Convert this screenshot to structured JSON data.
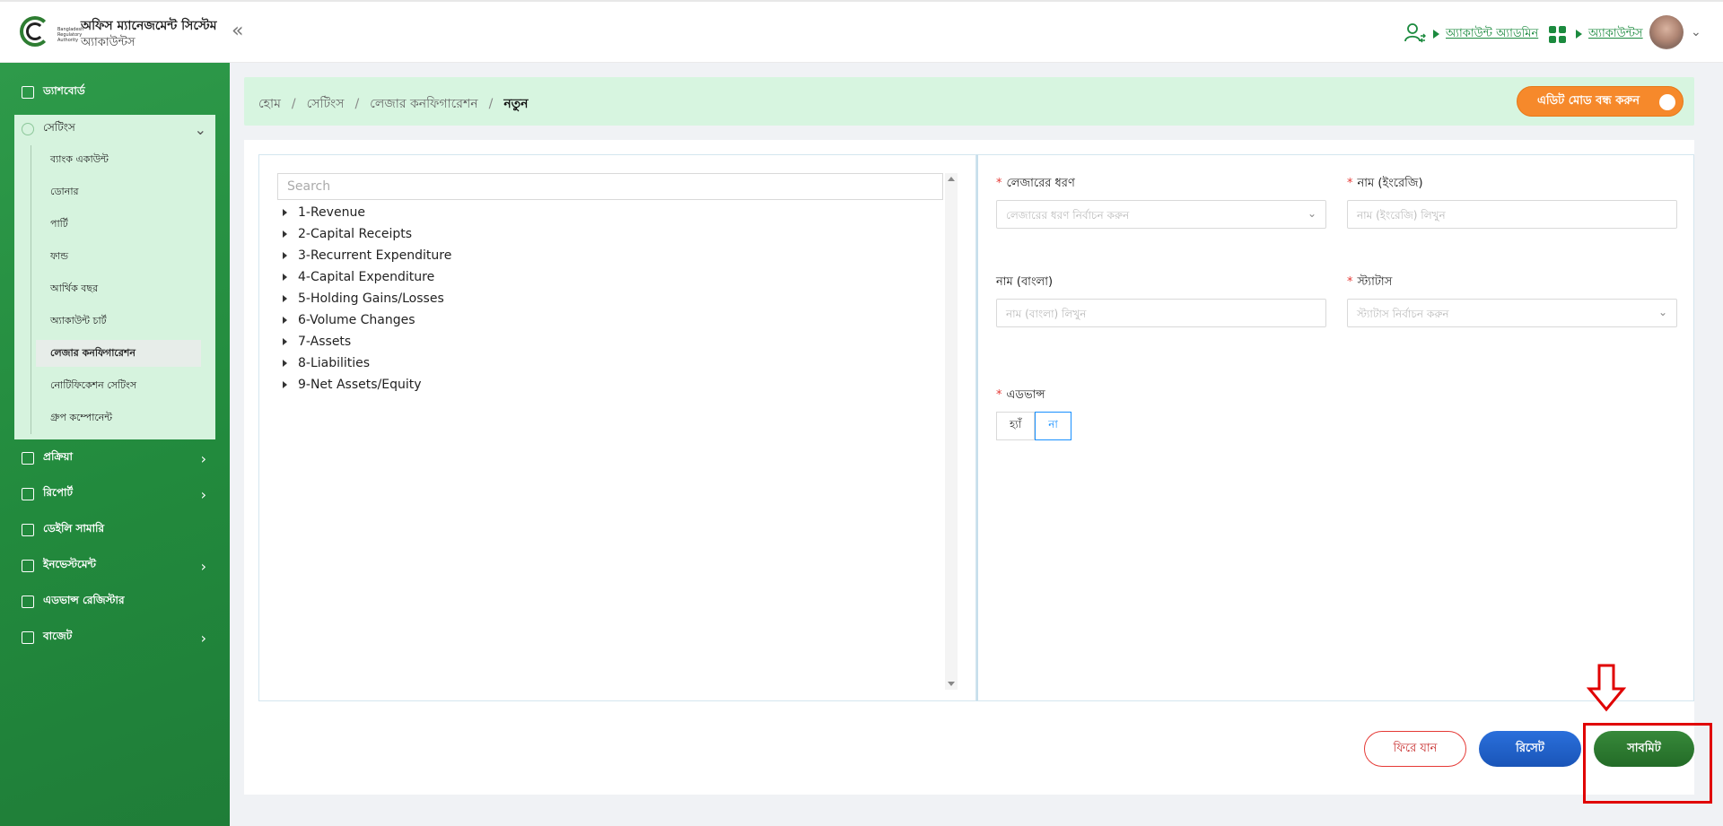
{
  "header": {
    "logo_text": "Bangladesh Regulatory Authority",
    "app_title": "অফিস ম্যানেজমেন্ট সিস্টেম",
    "app_subtitle": "অ্যাকাউন্টস",
    "collapse_glyph": "«",
    "user_link": "অ্যাকাউন্ট অ্যাডমিন",
    "module_link": "অ্যাকাউন্টস"
  },
  "sidebar": {
    "items": [
      {
        "label": "ড্যাশবোর্ড"
      },
      {
        "label": "প্রক্রিয়া"
      },
      {
        "label": "রিপোর্ট"
      },
      {
        "label": "ডেইলি সামারি"
      },
      {
        "label": "ইনভেস্টমেন্ট"
      },
      {
        "label": "এডভান্স রেজিস্টার"
      },
      {
        "label": "বাজেট"
      }
    ],
    "settings": {
      "label": "সেটিংস",
      "children": [
        {
          "label": "ব্যাংক একাউন্ট"
        },
        {
          "label": "ডোনার"
        },
        {
          "label": "পার্টি"
        },
        {
          "label": "ফান্ড"
        },
        {
          "label": "আর্থিক বছর"
        },
        {
          "label": "অ্যাকাউন্ট চার্ট"
        },
        {
          "label": "লেজার কনফিগারেশন"
        },
        {
          "label": "নোটিফিকেশন সেটিংস"
        },
        {
          "label": "গ্রুপ কম্পোনেন্ট"
        }
      ]
    }
  },
  "breadcrumb": {
    "home": "হোম",
    "settings": "সেটিংস",
    "ledger_config": "লেজার কনফিগারেশন",
    "current": "নতুন",
    "separator": "/"
  },
  "edit_mode": {
    "label": "এডিট মোড বন্ধ করুন"
  },
  "tree": {
    "search_placeholder": "Search",
    "nodes": [
      "1-Revenue",
      "2-Capital Receipts",
      "3-Recurrent Expenditure",
      "4-Capital Expenditure",
      "5-Holding Gains/Losses",
      "6-Volume Changes",
      "7-Assets",
      "8-Liabilities",
      "9-Net Assets/Equity"
    ]
  },
  "form": {
    "required_mark": "*",
    "ledger_type": {
      "label": "লেজারের ধরণ",
      "placeholder": "লেজারের ধরণ নির্বাচন করুন"
    },
    "name_en": {
      "label": "নাম (ইংরেজি)",
      "placeholder": "নাম (ইংরেজি) লিখুন"
    },
    "name_bn": {
      "label": "নাম (বাংলা)",
      "placeholder": "নাম (বাংলা) লিখুন"
    },
    "status": {
      "label": "স্ট্যাটাস",
      "placeholder": "স্ট্যাটাস নির্বাচন করুন"
    },
    "advance": {
      "label": "এডভান্স",
      "yes": "হ্যাঁ",
      "no": "না",
      "selected": "না"
    }
  },
  "buttons": {
    "back": "ফিরে যান",
    "reset": "রিসেট",
    "submit": "সাবমিট"
  },
  "colors": {
    "primary_green": "#228a3d",
    "accent_orange": "#f6892b",
    "reset_blue": "#1a55b8",
    "highlight_red": "#e00000"
  }
}
